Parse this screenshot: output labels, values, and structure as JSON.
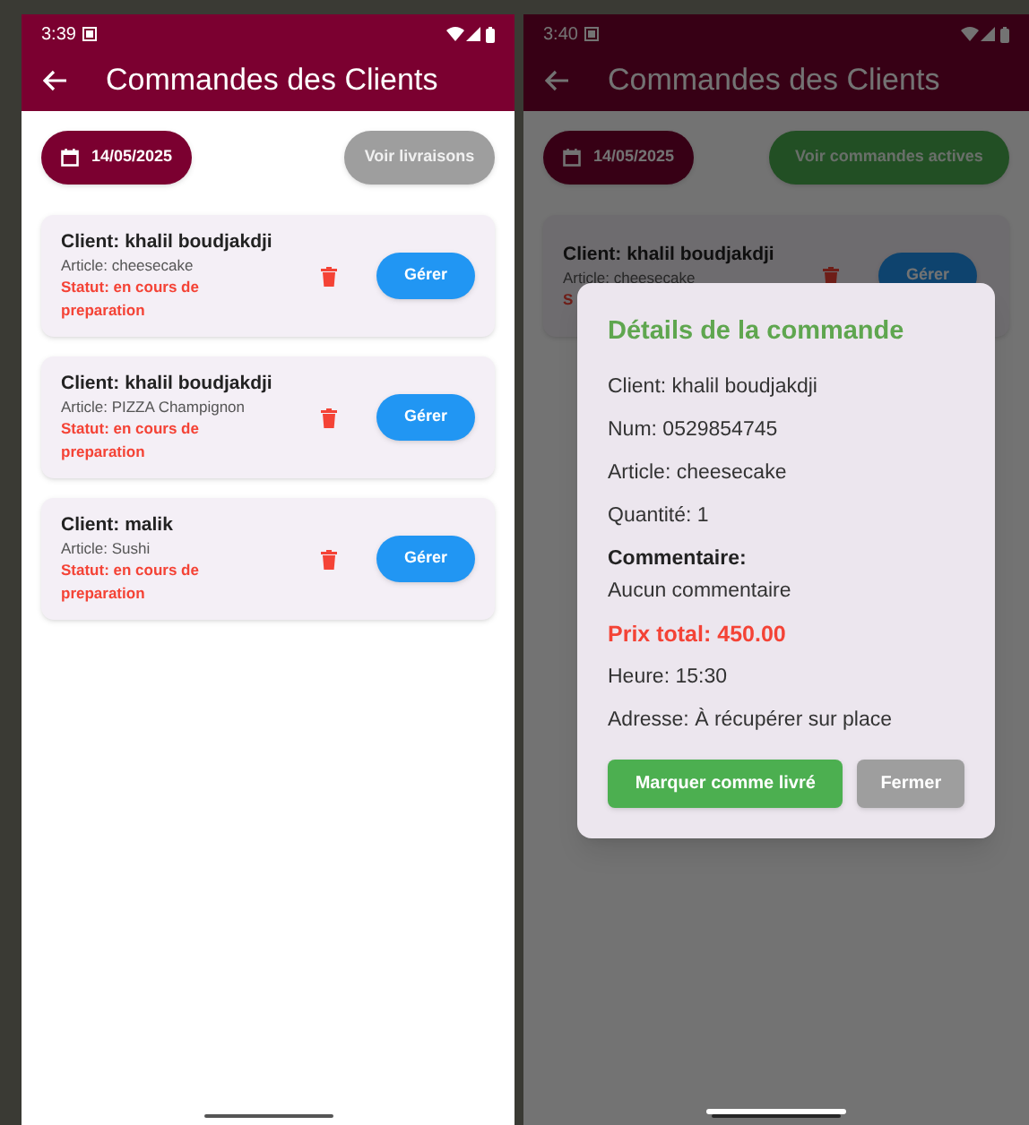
{
  "screens": [
    {
      "status_bar": {
        "time": "3:39"
      },
      "app_bar": {
        "title": "Commandes des Clients"
      },
      "date_button": "14/05/2025",
      "toggle_button": {
        "label": "Voir livraisons",
        "kind": "deliveries"
      },
      "orders": [
        {
          "client": "Client: khalil boudjakdji",
          "article": "Article: cheesecake",
          "status": "Statut: en cours de preparation",
          "action": "Gérer"
        },
        {
          "client": "Client: khalil boudjakdji",
          "article": "Article: PIZZA Champignon",
          "status": "Statut: en cours de preparation",
          "action": "Gérer"
        },
        {
          "client": "Client: malik",
          "article": "Article: Sushi",
          "status": "Statut: en cours de preparation",
          "action": "Gérer"
        }
      ]
    },
    {
      "status_bar": {
        "time": "3:40"
      },
      "app_bar": {
        "title": "Commandes des Clients"
      },
      "date_button": "14/05/2025",
      "toggle_button": {
        "label": "Voir commandes actives",
        "kind": "active"
      },
      "orders": [
        {
          "client": "Client: khalil boudjakdji",
          "article": "Article: cheesecake",
          "status": "S",
          "action": "Gérer"
        }
      ],
      "dialog": {
        "title": "Détails de la commande",
        "lines": [
          {
            "kind": "text",
            "text": "Client: khalil boudjakdji"
          },
          {
            "kind": "text",
            "text": "Num: 0529854745"
          },
          {
            "kind": "text",
            "text": "Article: cheesecake"
          },
          {
            "kind": "text",
            "text": "Quantité: 1"
          },
          {
            "kind": "heading",
            "text": "Commentaire:"
          },
          {
            "kind": "note",
            "text": "Aucun commentaire"
          },
          {
            "kind": "price",
            "text": "Prix total: 450.00"
          },
          {
            "kind": "text",
            "text": "Heure: 15:30"
          },
          {
            "kind": "text",
            "text": "Adresse: À récupérer sur place"
          }
        ],
        "buttons": [
          {
            "label": "Marquer comme livré",
            "kind": "primary"
          },
          {
            "label": "Fermer",
            "kind": "secondary"
          }
        ]
      }
    }
  ]
}
